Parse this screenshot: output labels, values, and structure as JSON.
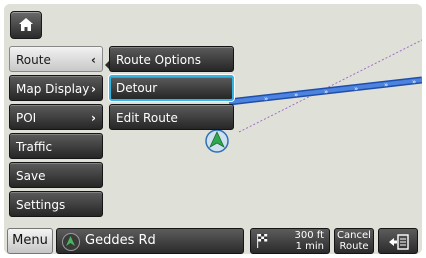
{
  "colors": {
    "map_bg": "#dfe1d9",
    "route_line": "#2f63c9",
    "highlight": "#34b5e4",
    "vehicle": "#2fa84f"
  },
  "header": {
    "home_icon": "home-icon"
  },
  "menu": {
    "items": [
      {
        "label": "Route",
        "chevron": "‹",
        "active": true
      },
      {
        "label": "Map Display",
        "chevron": "›",
        "active": false
      },
      {
        "label": "POI",
        "chevron": "›",
        "active": false
      },
      {
        "label": "Traffic",
        "chevron": "",
        "active": false
      },
      {
        "label": "Save",
        "chevron": "",
        "active": false
      },
      {
        "label": "Settings",
        "chevron": "",
        "active": false
      }
    ]
  },
  "submenu": {
    "items": [
      {
        "label": "Route Options",
        "highlighted": false
      },
      {
        "label": "Detour",
        "highlighted": true
      },
      {
        "label": "Edit Route",
        "highlighted": false
      }
    ]
  },
  "bottom": {
    "menu_label": "Menu",
    "street": "Geddes Rd",
    "distance": "300 ft",
    "time": "1 min",
    "cancel_line1": "Cancel",
    "cancel_line2": "Route",
    "exit_icon": "exit-icon"
  }
}
